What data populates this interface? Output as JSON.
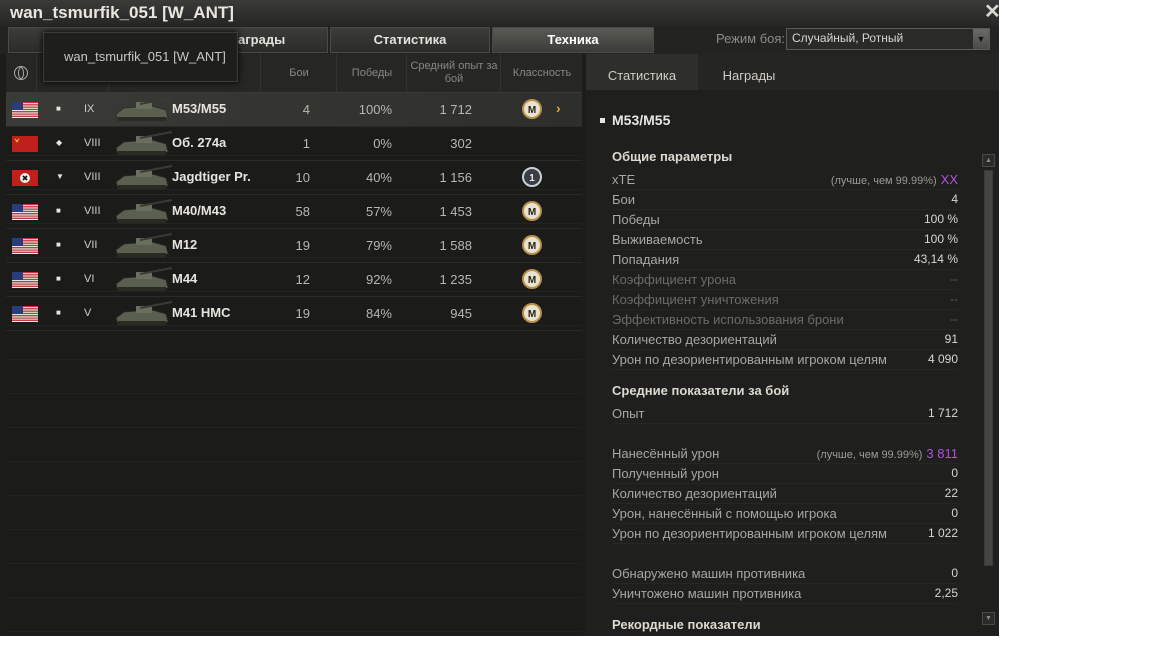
{
  "window": {
    "title": "wan_tsmurfik_051 [W_ANT]"
  },
  "tabs": [
    "Награды",
    "Статистика",
    "Техника"
  ],
  "tabs_visible_text": {
    "awards_partial": "аграды"
  },
  "battle_mode": {
    "label": "Режим боя:",
    "value": "Случайный, Ротный"
  },
  "tooltip": {
    "text": "wan_tsmurfik_051 [W_ANT]"
  },
  "table": {
    "headers": {
      "battles": "Бои",
      "wins": "Победы",
      "avg_exp": "Средний опыт за бой",
      "mastery": "Классность"
    },
    "rows": [
      {
        "nation": "USA",
        "type": "spg",
        "tier": "IX",
        "name": "M53/M55",
        "battles": "4",
        "wins": "100%",
        "exp": "1 712",
        "mastery": "M",
        "selected": true
      },
      {
        "nation": "USSR",
        "type": "heavy",
        "tier": "VIII",
        "name": "Об. 274а",
        "battles": "1",
        "wins": "0%",
        "exp": "302",
        "mastery": ""
      },
      {
        "nation": "Germany",
        "type": "td",
        "tier": "VIII",
        "name": "Jagdtiger Pr.",
        "battles": "10",
        "wins": "40%",
        "exp": "1 156",
        "mastery": "1"
      },
      {
        "nation": "USA",
        "type": "spg",
        "tier": "VIII",
        "name": "M40/M43",
        "battles": "58",
        "wins": "57%",
        "exp": "1 453",
        "mastery": "M"
      },
      {
        "nation": "USA",
        "type": "spg",
        "tier": "VII",
        "name": "M12",
        "battles": "19",
        "wins": "79%",
        "exp": "1 588",
        "mastery": "M"
      },
      {
        "nation": "USA",
        "type": "spg",
        "tier": "VI",
        "name": "M44",
        "battles": "12",
        "wins": "92%",
        "exp": "1 235",
        "mastery": "M"
      },
      {
        "nation": "USA",
        "type": "spg",
        "tier": "V",
        "name": "M41 HMC",
        "battles": "19",
        "wins": "84%",
        "exp": "945",
        "mastery": "M"
      }
    ]
  },
  "right_panel": {
    "tabs": [
      "Статистика",
      "Награды"
    ],
    "vehicle": "M53/M55",
    "general": {
      "title": "Общие параметры",
      "xte": {
        "label": "xTE",
        "note": "(лучше, чем 99.99%)",
        "value": "XX"
      },
      "battles": {
        "label": "Бои",
        "value": "4"
      },
      "wins": {
        "label": "Победы",
        "value": "100 %"
      },
      "survival": {
        "label": "Выживаемость",
        "value": "100 %"
      },
      "hits": {
        "label": "Попадания",
        "value": "43,14 %"
      },
      "dmg_coef": {
        "label": "Коэффициент урона",
        "value": "--"
      },
      "kill_coef": {
        "label": "Коэффициент уничтожения",
        "value": "--"
      },
      "armor_eff": {
        "label": "Эффективность использования брони",
        "value": "--"
      },
      "stuns": {
        "label": "Количество дезориентаций",
        "value": "91"
      },
      "stun_dmg": {
        "label": "Урон по дезориентированным игроком целям",
        "value": "4 090"
      }
    },
    "avg": {
      "title": "Средние показатели за бой",
      "exp": {
        "label": "Опыт",
        "value": "1 712"
      },
      "dmg": {
        "label": "Нанесённый урон",
        "note": "(лучше, чем 99.99%)",
        "value": "3 811"
      },
      "recv": {
        "label": "Полученный урон",
        "value": "0"
      },
      "stuns": {
        "label": "Количество дезориентаций",
        "value": "22"
      },
      "assist": {
        "label": "Урон, нанесённый с помощью игрока",
        "value": "0"
      },
      "stun_dmg": {
        "label": "Урон по дезориентированным игроком целям",
        "value": "1 022"
      },
      "spotted": {
        "label": "Обнаружено машин противника",
        "value": "0"
      },
      "killed": {
        "label": "Уничтожено машин противника",
        "value": "2,25"
      }
    },
    "records": {
      "title": "Рекордные показатели"
    }
  },
  "colors": {
    "accent_purple": "#b050e0",
    "chevron_orange": "#e3a33d"
  }
}
